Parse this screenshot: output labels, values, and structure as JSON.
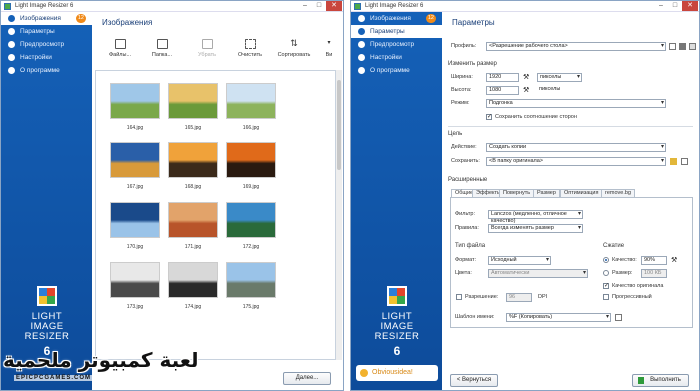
{
  "left_window": {
    "title": "Light Image Resizer 6",
    "nav": [
      {
        "label": "Изображения",
        "badge": "12"
      },
      {
        "label": "Параметры"
      },
      {
        "label": "Предпросмотр"
      },
      {
        "label": "Настройки"
      },
      {
        "label": "О программе"
      }
    ],
    "logo": {
      "line1": "LIGHT",
      "line2": "IMAGE",
      "line3": "RESIZER",
      "version": "6"
    },
    "heading": "Изображения",
    "toolbar": [
      "Файлы...",
      "Папка...",
      "Убрать",
      "Очистить",
      "Сортировать",
      "Ви"
    ],
    "thumbs": [
      {
        "caption": "164.jpg",
        "colors": [
          "#9fc7e8",
          "#7aa84a"
        ]
      },
      {
        "caption": "165.jpg",
        "colors": [
          "#e8c26a",
          "#6b9a3a"
        ]
      },
      {
        "caption": "166.jpg",
        "colors": [
          "#cfe2f2",
          "#8db35c"
        ]
      },
      {
        "caption": "167.jpg",
        "colors": [
          "#2a5fa8",
          "#d89a3a"
        ]
      },
      {
        "caption": "168.jpg",
        "colors": [
          "#f0a23a",
          "#3b2a1a"
        ]
      },
      {
        "caption": "169.jpg",
        "colors": [
          "#e06a1a",
          "#2a1a10"
        ]
      },
      {
        "caption": "170.jpg",
        "colors": [
          "#1a4a8a",
          "#9ac3e8"
        ]
      },
      {
        "caption": "171.jpg",
        "colors": [
          "#e2a36a",
          "#b8542a"
        ]
      },
      {
        "caption": "172.jpg",
        "colors": [
          "#3a8ac8",
          "#2a6a3a"
        ]
      },
      {
        "caption": "173.jpg",
        "colors": [
          "#e8e8e8",
          "#4a4a4a"
        ]
      },
      {
        "caption": "174.jpg",
        "colors": [
          "#d8d8d8",
          "#2a2a2a"
        ]
      },
      {
        "caption": "175.jpg",
        "colors": [
          "#9ac3e8",
          "#6a7a6a"
        ]
      }
    ],
    "next_button": "Далее..."
  },
  "right_window": {
    "title": "Light Image Resizer 6",
    "nav": [
      {
        "label": "Изображения",
        "badge": "12"
      },
      {
        "label": "Параметры"
      },
      {
        "label": "Предпросмотр"
      },
      {
        "label": "Настройки"
      },
      {
        "label": "О программе"
      }
    ],
    "logo": {
      "line1": "LIGHT",
      "line2": "IMAGE",
      "line3": "RESIZER",
      "version": "6"
    },
    "heading": "Параметры",
    "profile_label": "Профиль:",
    "profile_value": "<Разрешение рабочего стола>",
    "resize_section": "Изменить размер",
    "width_label": "Ширина:",
    "width_value": "1920",
    "width_unit": "пикселы",
    "height_label": "Высота:",
    "height_value": "1080",
    "height_unit": "пикселы",
    "mode_label": "Режим:",
    "mode_value": "Подгонка",
    "keep_ratio": "Сохранить соотношение сторон",
    "target_section": "Цель",
    "action_label": "Действие:",
    "action_value": "Создать копии",
    "save_label": "Сохранить:",
    "save_value": "<В папку оригинала>",
    "advanced_section": "Расширенные",
    "tabs": [
      "Общие",
      "Эффекты",
      "Повернуть",
      "Размер",
      "Оптимизация",
      "remove.bg"
    ],
    "filter_label": "Фильтр:",
    "filter_value": "Lanczos (медленно, отличное качество)",
    "rules_label": "Правила:",
    "rules_value": "Всегда изменять размер",
    "filetype_section": "Тип файла",
    "format_label": "Формат:",
    "format_value": "Исходный",
    "colors_label": "Цвета:",
    "colors_value": "Автоматически",
    "resolution_label": "Разрешение:",
    "resolution_value": "96",
    "resolution_unit": "DPI",
    "compression_section": "Сжатие",
    "quality_label": "Качество:",
    "quality_value": "90%",
    "size_label": "Размер:",
    "size_value": "100 КБ",
    "keep_quality": "Качество оригинала",
    "progressive": "Прогрессивный",
    "template_label": "Шаблон имени:",
    "template_value": "%F (Копировать)",
    "back_button": "< Вернуться",
    "run_button": "Выполнить",
    "brand": "Obviousidea!"
  },
  "watermark": {
    "main": "لعبة كمبيوتر ملحمية",
    "sub": "EPICPCGAMES.COM"
  }
}
